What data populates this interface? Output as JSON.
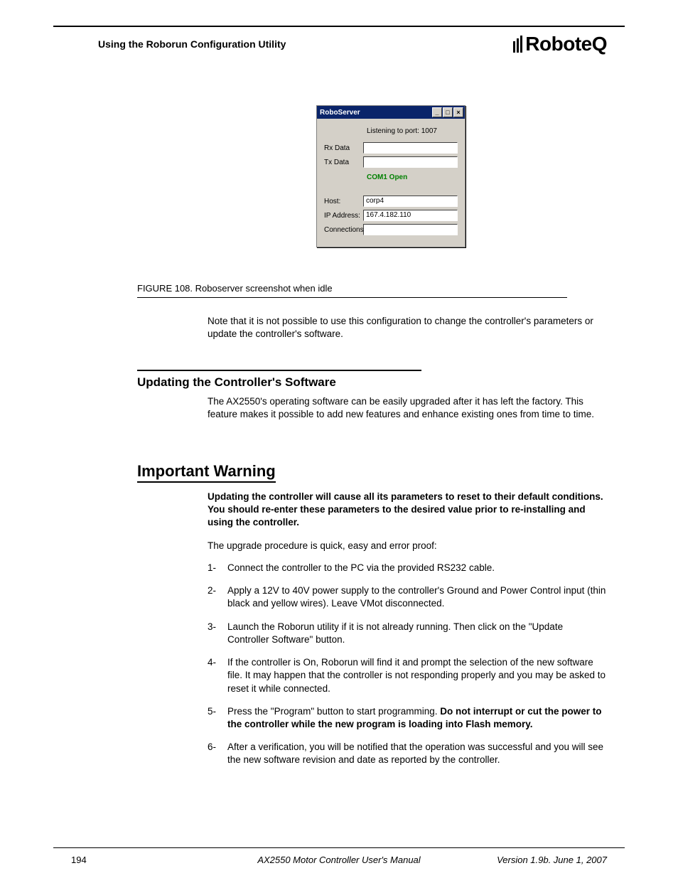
{
  "header": {
    "section": "Using the Roborun Configuration Utility",
    "brand": "RoboteQ"
  },
  "window": {
    "title": "RoboServer",
    "listening": "Listening to port: 1007",
    "rx_label": "Rx Data",
    "tx_label": "Tx Data",
    "com_status": "COM1 Open",
    "host_label": "Host:",
    "host_value": "corp4",
    "ip_label": "IP Address:",
    "ip_value": "167.4.182.110",
    "conn_label": "Connections:"
  },
  "figure": {
    "caption": "FIGURE 108. Roboserver screenshot when idle"
  },
  "body": {
    "note1": "Note that it is not possible to use this configuration to change the controller's parameters or update the controller's software.",
    "h2": "Updating the Controller's Software",
    "para2": "The AX2550's operating software can be easily upgraded after it has left the factory. This feature makes it possible to add new features and enhance existing ones from time to time.",
    "h1": "Important Warning",
    "warning": "Updating the controller will cause all its parameters to reset to their default conditions. You should re-enter these parameters to the desired value prior to re-installing and using the controller.",
    "para3": "The upgrade procedure is quick, easy and error proof:",
    "steps": [
      {
        "n": "1-",
        "t": "Connect the controller to the PC via the provided RS232 cable."
      },
      {
        "n": "2-",
        "t": "Apply a 12V to 40V power supply to the controller's Ground and Power Control input (thin black and yellow wires). Leave VMot disconnected."
      },
      {
        "n": "3-",
        "t": "Launch the Roborun utility if it is not already running. Then click on the \"Update Controller Software\" button."
      },
      {
        "n": "4-",
        "t": "If the controller is On, Roborun will find it and prompt the selection of the new software file. It may happen that the controller is not responding properly and you may be asked to reset it while connected."
      },
      {
        "n": "5-",
        "t_pre": "Press the \"Program\" button to start programming. ",
        "t_bold": "Do not interrupt or cut the power to the controller while the new program is loading into Flash memory."
      },
      {
        "n": "6-",
        "t": "After a verification, you will be notified that the operation was successful and you will see the new software revision and date as reported by the controller."
      }
    ]
  },
  "footer": {
    "page": "194",
    "title": "AX2550 Motor Controller User's Manual",
    "version": "Version 1.9b. June 1, 2007"
  }
}
